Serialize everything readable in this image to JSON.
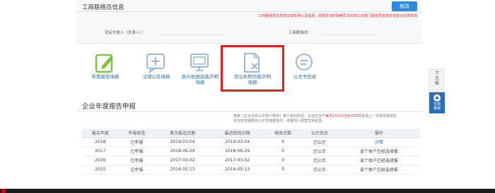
{
  "card": {
    "title": "工商联络员信息",
    "button": "修改",
    "warning": "工商联络员信息变动或有误以及错误，需要变动的联络员请先到工商部门联络员信息变动登记后再修改",
    "legal_rep_label": "法定代表人（负责人）：",
    "liaison_phone_label": "工商联络员："
  },
  "actions": [
    {
      "line1": "年度报告填报",
      "line2": ""
    },
    {
      "line1": "注销公告填报",
      "line2": ""
    },
    {
      "line1": "执行依据自我声明",
      "line2": "填报"
    },
    {
      "line1": "营业执照作废声明",
      "line2": "填报"
    },
    {
      "line1": "公文书签收",
      "line2": ""
    }
  ],
  "section": {
    "title": "企业年度报告申报",
    "note_a": "根据《企业信息公示暂行条例》第八条的规定，企业应当于",
    "note_red": "每年1月1日至6月30日",
    "note_b": "报送上一年度年度报告",
    "note_line2": "未在规定期限内公示年度报告的，将被列入经营异常名录。"
  },
  "table": {
    "headers": [
      "报告年度",
      "年报状态",
      "首次报送日期",
      "最近修改日期",
      "修改次数",
      "公示状态",
      "操作"
    ],
    "rows": [
      [
        "2018",
        "已年报",
        "2019-03-04",
        "2019-03-04",
        "0",
        "已公示",
        "详情"
      ],
      [
        "2017",
        "已年报",
        "2018-06-29",
        "2018-06-29",
        "0",
        "已公示",
        "该个体户已经选择报"
      ],
      [
        "2016",
        "已年报",
        "2017-03-02",
        "2017-03-02",
        "0",
        "已公示",
        "该个体户已经选择报"
      ],
      [
        "2015",
        "已年报",
        "2016-05-13",
        "2016-05-13",
        "0",
        "已公示",
        "该个体户已经选择报"
      ]
    ]
  },
  "side": {
    "top_label": "下\n次\n报",
    "bottom_label": "在线\n客服"
  },
  "colors": {
    "accent": "#2b8cde",
    "link": "#2b6fb8",
    "warning": "#e33333",
    "highlight": "#e02020"
  }
}
